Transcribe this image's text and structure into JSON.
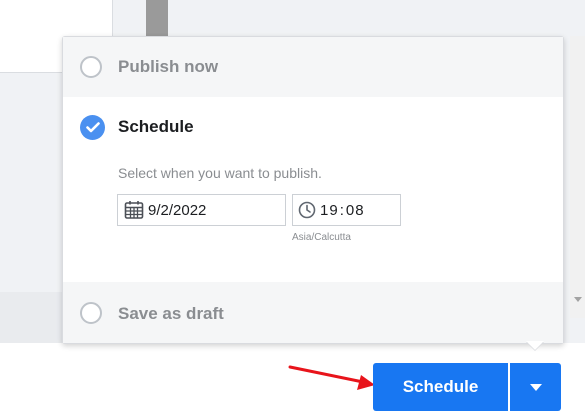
{
  "popup": {
    "options": [
      {
        "label": "Publish now",
        "selected": false
      },
      {
        "label": "Schedule",
        "selected": true
      },
      {
        "label": "Save as draft",
        "selected": false
      }
    ],
    "schedule": {
      "hint": "Select when you want to publish.",
      "date": "9/2/2022",
      "time_hour": "19",
      "time_minute": "08",
      "timezone": "Asia/Calcutta"
    }
  },
  "footer": {
    "schedule_label": "Schedule"
  },
  "colors": {
    "accent": "#1877f2",
    "check": "#4a90f0",
    "annotation_arrow": "#e8141b"
  },
  "icons": {
    "calendar": "calendar-icon",
    "clock": "clock-icon",
    "dropdown": "chevron-down-icon"
  }
}
